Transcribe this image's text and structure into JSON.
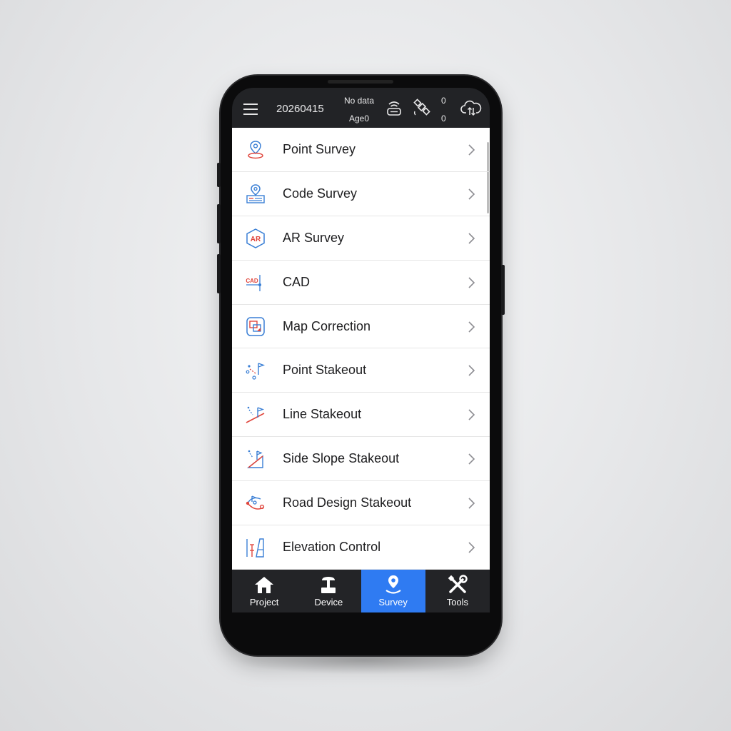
{
  "status_bar": {
    "project_name": "20260415",
    "solution_status": "No data",
    "age": "Age0",
    "sat_count_top": "0",
    "sat_count_bottom": "0",
    "icons": [
      "menu-icon",
      "receiver-icon",
      "satellite-icon",
      "cloud-sync-icon"
    ]
  },
  "menu": {
    "items": [
      {
        "label": "Point Survey",
        "icon": "point-survey-icon"
      },
      {
        "label": "Code Survey",
        "icon": "code-survey-icon"
      },
      {
        "label": "AR Survey",
        "icon": "ar-survey-icon",
        "icon_text": "AR"
      },
      {
        "label": "CAD",
        "icon": "cad-icon",
        "icon_text": "CAD"
      },
      {
        "label": "Map Correction",
        "icon": "map-correction-icon"
      },
      {
        "label": "Point Stakeout",
        "icon": "point-stakeout-icon"
      },
      {
        "label": "Line Stakeout",
        "icon": "line-stakeout-icon"
      },
      {
        "label": "Side Slope Stakeout",
        "icon": "side-slope-stakeout-icon"
      },
      {
        "label": "Road Design Stakeout",
        "icon": "road-design-stakeout-icon"
      },
      {
        "label": "Elevation Control",
        "icon": "elevation-control-icon"
      }
    ]
  },
  "tab_bar": {
    "tabs": [
      {
        "label": "Project",
        "icon": "home-icon",
        "active": false
      },
      {
        "label": "Device",
        "icon": "device-icon",
        "active": false
      },
      {
        "label": "Survey",
        "icon": "survey-pin-icon",
        "active": true
      },
      {
        "label": "Tools",
        "icon": "tools-icon",
        "active": false
      }
    ]
  },
  "colors": {
    "accent": "#2f7bf2",
    "icon_blue": "#3a7fd5",
    "icon_red": "#e0473e",
    "status_bar_bg": "#222326",
    "tab_bar_bg": "#232427"
  }
}
